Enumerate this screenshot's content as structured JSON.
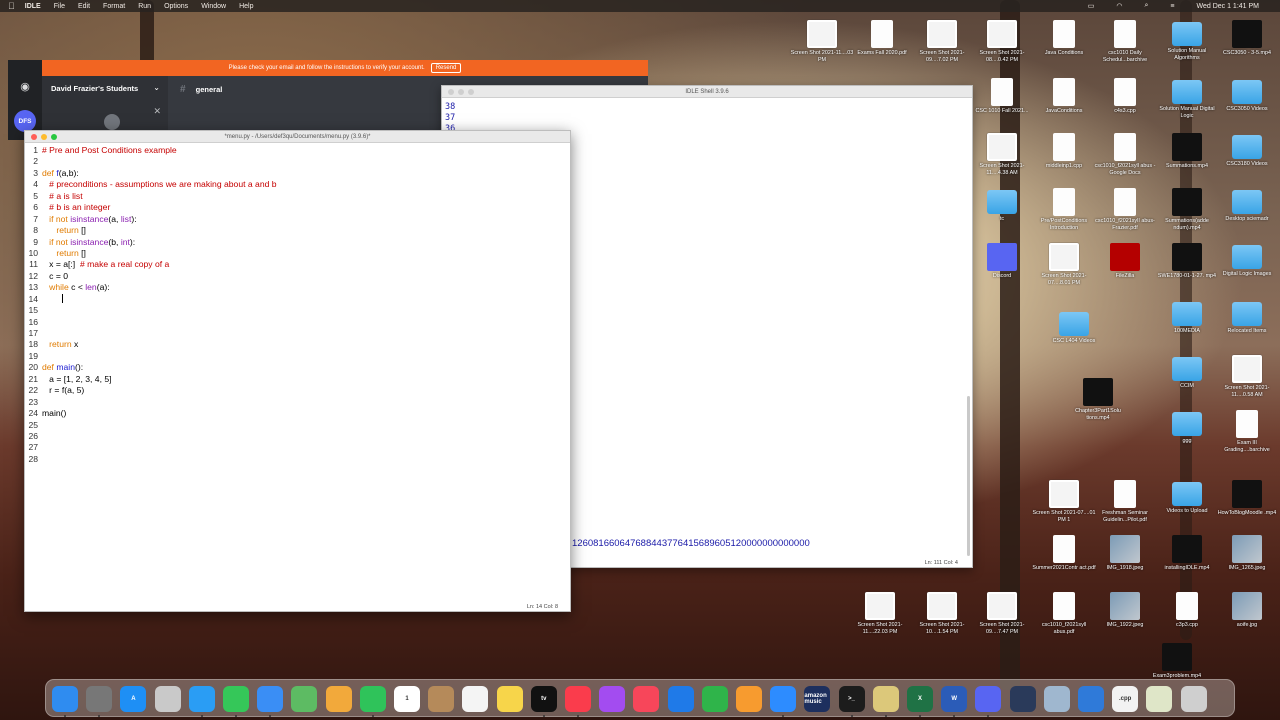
{
  "menubar": {
    "app": "IDLE",
    "items": [
      "File",
      "Edit",
      "Format",
      "Run",
      "Options",
      "Window",
      "Help"
    ],
    "clock": "Wed Dec 1  1:41 PM"
  },
  "discord": {
    "banner": "Please check your email and follow the instructions to verify your account.",
    "resend": "Resend",
    "server": "David Frazier's Students",
    "channel": "general",
    "badge": "DFS"
  },
  "shell": {
    "title": "IDLE Shell 3.9.6",
    "lines": [
      "38",
      "37",
      "36"
    ],
    "output": "126081660647688443776415689605120000000000000",
    "status": "Ln: 111  Col: 4"
  },
  "editor": {
    "title": "*menu.py - /Users/def3qu/Documents/menu.py (3.9.6)*",
    "status": "Ln: 14  Col: 8",
    "lines": [
      {
        "n": "1"
      },
      {
        "n": "2"
      },
      {
        "n": "3"
      },
      {
        "n": "4"
      },
      {
        "n": "5"
      },
      {
        "n": "6"
      },
      {
        "n": "7"
      },
      {
        "n": "8"
      },
      {
        "n": "9"
      },
      {
        "n": "10"
      },
      {
        "n": "11"
      },
      {
        "n": "12"
      },
      {
        "n": "13"
      },
      {
        "n": "14"
      },
      {
        "n": "15"
      },
      {
        "n": "16"
      },
      {
        "n": "17"
      },
      {
        "n": "18"
      },
      {
        "n": "19"
      },
      {
        "n": "20"
      },
      {
        "n": "21"
      },
      {
        "n": "22"
      },
      {
        "n": "23"
      },
      {
        "n": "24"
      },
      {
        "n": "25"
      },
      {
        "n": "26"
      },
      {
        "n": "27"
      },
      {
        "n": "28"
      }
    ],
    "code": {
      "l1": "# Pre and Post Conditions example",
      "l3_kw": "def ",
      "l3_name": "f",
      "l3_rest": "(a,b):",
      "l4": "   # preconditions - assumptions we are making about a and b",
      "l5": "   # a is list",
      "l6": "   # b is an integer",
      "l7_kw": "   if not ",
      "l7_bi": "isinstance",
      "l7_rest": "(a, ",
      "l7_bi2": "list",
      "l7_end": "):",
      "l8_kw": "      return ",
      "l8_rest": "[]",
      "l9_kw": "   if not ",
      "l9_bi": "isinstance",
      "l9_rest": "(b, ",
      "l9_bi2": "int",
      "l9_end": "):",
      "l10_kw": "      return ",
      "l10_rest": "[]",
      "l11_code": "   x = a[:]  ",
      "l11_cm": "# make a real copy of a",
      "l12": "   c = 0",
      "l13_kw": "   while ",
      "l13_rest": "c < ",
      "l13_bi": "len",
      "l13_end": "(a):",
      "l18_kw": "   return ",
      "l18_rest": "x",
      "l20_kw": "def ",
      "l20_name": "main",
      "l20_rest": "():",
      "l21": "   a = [1, 2, 3, 4, 5]",
      "l22": "   r = f(a, 5)",
      "l24": "main()"
    }
  },
  "desktop": {
    "icons": [
      {
        "label": "Screen Shot 2021-11....03 PM",
        "kind": "shot"
      },
      {
        "label": "Exams Fall 2020.pdf",
        "kind": "doc"
      },
      {
        "label": "Screen Shot 2021-09....7.02 PM",
        "kind": "shot"
      },
      {
        "label": "Screen Shot 2021-08....0.42 PM",
        "kind": "shot"
      },
      {
        "label": "Java Conditions",
        "kind": "doc"
      },
      {
        "label": "csc1010 Daily Schedul...barchive",
        "kind": "doc"
      },
      {
        "label": "Solution Manual Algorithms",
        "kind": "folder"
      },
      {
        "label": "CSC3050 - 3-5.mp4",
        "kind": "video"
      },
      {
        "label": "CSC 1010 Fall 2021...",
        "kind": "doc"
      },
      {
        "label": "JavaConditions",
        "kind": "doc"
      },
      {
        "label": "c4s3.cpp",
        "kind": "doc"
      },
      {
        "label": "Solution Manual Digital Logic",
        "kind": "folder"
      },
      {
        "label": "CSC3050 Videos",
        "kind": "folder"
      },
      {
        "label": "Screen Shot 2021-11....4.38 AM",
        "kind": "shot"
      },
      {
        "label": "middleinp1.cpp",
        "kind": "doc"
      },
      {
        "label": "csc1010_f2021syll abus - Google Docs",
        "kind": "doc"
      },
      {
        "label": "Summations.mp4",
        "kind": "video"
      },
      {
        "label": "CSC3180 Videos",
        "kind": "folder"
      },
      {
        "label": "tc",
        "kind": "folder"
      },
      {
        "label": "Pre/PostConditions Introduction",
        "kind": "doc"
      },
      {
        "label": "csc1010_f2021sylI abus-Frazier.pdf",
        "kind": "doc"
      },
      {
        "label": "Summations(adde ndum).mp4",
        "kind": "video"
      },
      {
        "label": "Desktop sciemadr",
        "kind": "folder"
      },
      {
        "label": "Discord",
        "kind": "app"
      },
      {
        "label": "Screen Shot 2021-07....8.01 PM",
        "kind": "shot"
      },
      {
        "label": "FileZilla",
        "kind": "app"
      },
      {
        "label": "SWE1780-01-1-27. mp4",
        "kind": "video"
      },
      {
        "label": "Digital Logic Images",
        "kind": "folder"
      },
      {
        "label": "CSC L404 Videos",
        "kind": "folder"
      },
      {
        "label": "100MEDIA",
        "kind": "folder"
      },
      {
        "label": "Relocated Items",
        "kind": "folder"
      },
      {
        "label": "Chapter3Part1Solu tions.mp4",
        "kind": "video"
      },
      {
        "label": "CCIM",
        "kind": "folder"
      },
      {
        "label": "Screen Shot 2021-11....0.58 AM",
        "kind": "shot"
      },
      {
        "label": "ggg",
        "kind": "folder"
      },
      {
        "label": "Exam III Grading....barchive",
        "kind": "doc"
      },
      {
        "label": "Screen Shot 2021-07....01 PM 1",
        "kind": "shot"
      },
      {
        "label": "Freshman Seminar Guidelin...Pilot.pdf",
        "kind": "doc"
      },
      {
        "label": "Videos to Upload",
        "kind": "folder"
      },
      {
        "label": "HowToBlogMoodle .mp4",
        "kind": "video"
      },
      {
        "label": "Summer2021Contr act.pdf",
        "kind": "doc"
      },
      {
        "label": "IMG_1918.jpeg",
        "kind": "img"
      },
      {
        "label": "installingIDLE.mp4",
        "kind": "video"
      },
      {
        "label": "IMG_1265.jpeg",
        "kind": "img"
      },
      {
        "label": "Screen Shot 2021-11....22.03 PM",
        "kind": "shot"
      },
      {
        "label": "Screen Shot 2021-10....1.54 PM",
        "kind": "shot"
      },
      {
        "label": "Screen Shot 2021-09....7.47 PM",
        "kind": "shot"
      },
      {
        "label": "csc1010_f2021syll abus.pdf",
        "kind": "doc"
      },
      {
        "label": "IMG_1922.jpeg",
        "kind": "img"
      },
      {
        "label": "c3p3.cpp",
        "kind": "doc"
      },
      {
        "label": "aoife.jpg",
        "kind": "img"
      },
      {
        "label": "Exam3problem.mp4",
        "kind": "video"
      }
    ]
  },
  "dock": {
    "apps": [
      {
        "name": "finder-icon",
        "color": "#2f8cf0",
        "text": ""
      },
      {
        "name": "system-preferences-icon",
        "color": "#777777",
        "text": ""
      },
      {
        "name": "app-store-icon",
        "color": "#1e8ff5",
        "text": "A"
      },
      {
        "name": "launchpad-icon",
        "color": "#c9c9c9",
        "text": ""
      },
      {
        "name": "safari-icon",
        "color": "#2a9df4",
        "text": ""
      },
      {
        "name": "messages-icon",
        "color": "#35c759",
        "text": ""
      },
      {
        "name": "mail-icon",
        "color": "#3a8ef5",
        "text": ""
      },
      {
        "name": "maps-icon",
        "color": "#5dbb63",
        "text": ""
      },
      {
        "name": "photos-icon",
        "color": "#f2a93b",
        "text": ""
      },
      {
        "name": "facetime-icon",
        "color": "#2fc35a",
        "text": ""
      },
      {
        "name": "calendar-icon",
        "color": "#ffffff",
        "text": "1"
      },
      {
        "name": "contacts-icon",
        "color": "#b58a5a",
        "text": ""
      },
      {
        "name": "reminders-icon",
        "color": "#f4f4f4",
        "text": ""
      },
      {
        "name": "notes-icon",
        "color": "#f7d54a",
        "text": ""
      },
      {
        "name": "tv-icon",
        "color": "#111111",
        "text": "tv"
      },
      {
        "name": "music-icon",
        "color": "#fa3c4c",
        "text": ""
      },
      {
        "name": "podcasts-icon",
        "color": "#a34cf0",
        "text": ""
      },
      {
        "name": "news-icon",
        "color": "#f7465a",
        "text": ""
      },
      {
        "name": "keynote-icon",
        "color": "#1f7ae8",
        "text": ""
      },
      {
        "name": "numbers-icon",
        "color": "#2fb44a",
        "text": ""
      },
      {
        "name": "pages-icon",
        "color": "#f79b2f",
        "text": ""
      },
      {
        "name": "zoom-icon",
        "color": "#2d8cff",
        "text": ""
      },
      {
        "name": "amazon-music-icon",
        "color": "#1d2f5e",
        "text": "amazon music"
      },
      {
        "name": "terminal-icon",
        "color": "#1c1c1c",
        "text": ">_"
      },
      {
        "name": "python-icon",
        "color": "#dcc87a",
        "text": ""
      },
      {
        "name": "excel-icon",
        "color": "#1f7245",
        "text": "X"
      },
      {
        "name": "word-icon",
        "color": "#2b5cb8",
        "text": "W"
      },
      {
        "name": "discord-icon",
        "color": "#5865f2",
        "text": ""
      },
      {
        "name": "quicktime-icon",
        "color": "#2a3a5a",
        "text": ""
      },
      {
        "name": "preview-icon",
        "color": "#9fb7cf",
        "text": ""
      },
      {
        "name": "xcode-icon",
        "color": "#2f7ad9",
        "text": ""
      },
      {
        "name": "cpp-file-icon",
        "color": "#f2f2f2",
        "text": ".cpp"
      },
      {
        "name": "documents-stack-icon",
        "color": "#dfe6c8",
        "text": ""
      },
      {
        "name": "trash-icon",
        "color": "#cfcfcf",
        "text": ""
      }
    ]
  }
}
